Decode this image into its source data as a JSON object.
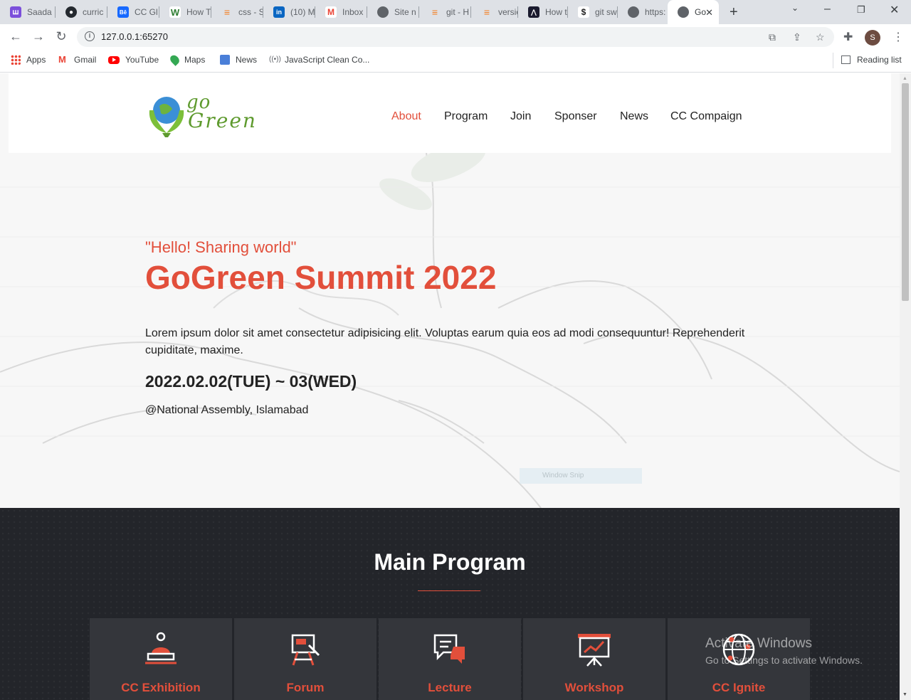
{
  "browser": {
    "tabs": [
      {
        "title": "Saada",
        "color": "#7b4fdb",
        "glyph": "ꟺ"
      },
      {
        "title": "curric",
        "color": "#24292f",
        "glyph": "●"
      },
      {
        "title": "CC Gl",
        "color": "#1769ff",
        "glyph": "Bē"
      },
      {
        "title": "How T",
        "color": "#2e7d32",
        "glyph": "W"
      },
      {
        "title": "css - S",
        "color": "#f48024",
        "glyph": "≡"
      },
      {
        "title": "(10) M",
        "color": "#0a66c2",
        "glyph": "in"
      },
      {
        "title": "Inbox",
        "color": "#ea4335",
        "glyph": "M"
      },
      {
        "title": "Site n",
        "color": "#5f6368",
        "glyph": "◐"
      },
      {
        "title": "git - H",
        "color": "#f48024",
        "glyph": "≡"
      },
      {
        "title": "versio",
        "color": "#f48024",
        "glyph": "≡"
      },
      {
        "title": "How t",
        "color": "#1a1a2e",
        "glyph": "⋀"
      },
      {
        "title": "git sw",
        "color": "#ffffff",
        "glyph": "$"
      },
      {
        "title": "https:",
        "color": "#5f6368",
        "glyph": "◐"
      },
      {
        "title": "Go",
        "color": "#5f6368",
        "glyph": "◐"
      }
    ],
    "url": "127.0.0.1:65270",
    "profile_initial": "S",
    "bookmarks": [
      {
        "label": "Apps",
        "icon": "apps-grid-icon"
      },
      {
        "label": "Gmail",
        "icon": "gmail-icon"
      },
      {
        "label": "YouTube",
        "icon": "youtube-icon"
      },
      {
        "label": "Maps",
        "icon": "maps-icon"
      },
      {
        "label": "News",
        "icon": "news-icon"
      },
      {
        "label": "JavaScript Clean Co...",
        "icon": "podcast-icon"
      }
    ],
    "reading_list": "Reading list"
  },
  "site": {
    "logo": {
      "go": "go",
      "reen": "reen",
      "alt_letter": "G"
    },
    "nav": [
      "About",
      "Program",
      "Join",
      "Sponser",
      "News",
      "CC Compaign"
    ],
    "active_nav": "About",
    "accent": "#e24f3b"
  },
  "hero": {
    "tagline": "\"Hello! Sharing world\"",
    "title": "GoGreen Summit 2022",
    "description": "Lorem ipsum dolor sit amet consectetur adipisicing elit. Voluptas earum quia eos ad modi consequuntur! Reprehenderit cupiditate, maxime.",
    "dates": "2022.02.02(TUE) ~ 03(WED)",
    "venue": "@National Assembly, Islamabad",
    "snip_label": "Window Snip"
  },
  "program": {
    "title": "Main Program",
    "items": [
      {
        "label": "CC Exhibition",
        "icon": "exhibition-icon"
      },
      {
        "label": "Forum",
        "icon": "easel-icon"
      },
      {
        "label": "Lecture",
        "icon": "chat-bubbles-icon"
      },
      {
        "label": "Workshop",
        "icon": "presentation-board-icon"
      },
      {
        "label": "CC Ignite",
        "icon": "globe-network-icon"
      }
    ]
  },
  "os_watermark": {
    "line1": "Activate Windows",
    "line2": "Go to Settings to activate Windows."
  }
}
